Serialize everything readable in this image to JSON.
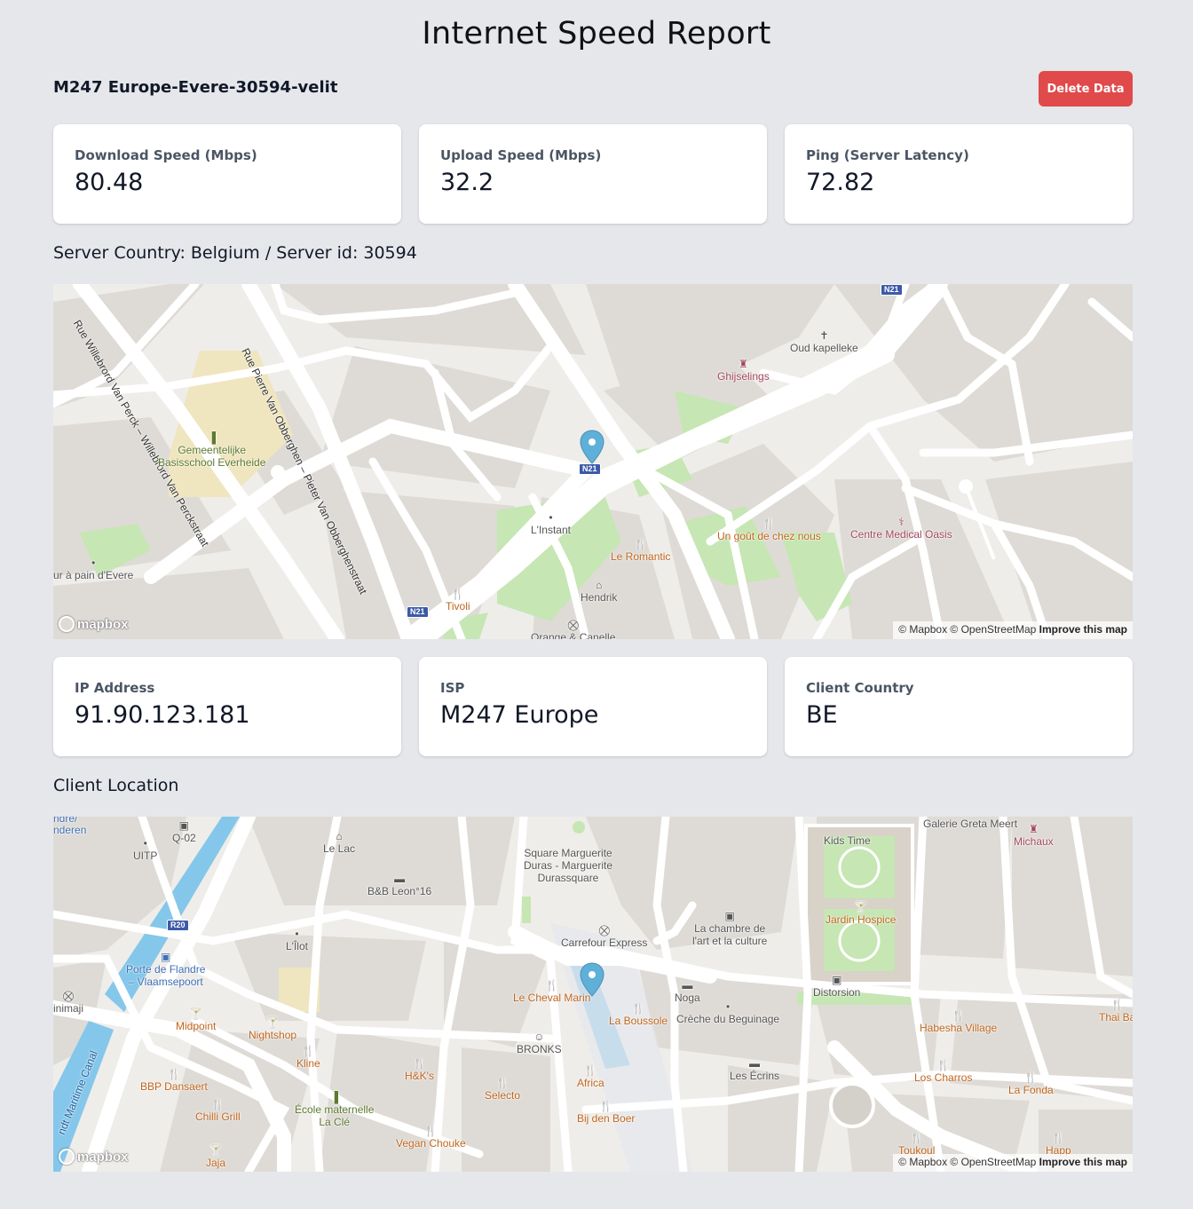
{
  "page_title": "Internet Speed Report",
  "server_name": "M247 Europe-Evere-30594-velit",
  "delete_button": "Delete Data",
  "metrics": [
    {
      "label": "Download Speed (Mbps)",
      "value": "80.48"
    },
    {
      "label": "Upload Speed (Mbps)",
      "value": "32.2"
    },
    {
      "label": "Ping (Server Latency)",
      "value": "72.82"
    }
  ],
  "server_location_label": "Server Country: Belgium / Server id: 30594",
  "client_info": [
    {
      "label": "IP Address",
      "value": "91.90.123.181"
    },
    {
      "label": "ISP",
      "value": "M247 Europe"
    },
    {
      "label": "Client Country",
      "value": "BE"
    }
  ],
  "client_location_label": "Client Location",
  "map_common": {
    "logo_text": "mapbox",
    "attribution": "© Mapbox © OpenStreetMap",
    "improve": "Improve this map",
    "marker_color": "#5fb0d8"
  },
  "server_map": {
    "streets": [
      "Rue Willebrord Van Perck – Willebrord Van Perckstraat",
      "Rue Pierre Van Obberghen – Pieter Van Obberghenstraat"
    ],
    "shields": [
      "N21",
      "N21",
      "N21"
    ],
    "pois": [
      {
        "name": "Oud kapelleke",
        "icon": "✝",
        "color": "gray"
      },
      {
        "name": "Ghijselings",
        "icon": "♜",
        "color": "pink"
      },
      {
        "name": "Gemeentelijke\nBasisschool Everheide",
        "icon": "▐",
        "color": "green"
      },
      {
        "name": "L'Instant",
        "icon": "•",
        "color": "gray"
      },
      {
        "name": "Le Romantic",
        "icon": "🍴",
        "color": "orange"
      },
      {
        "name": "Un goût de chez nous",
        "icon": "🍴",
        "color": "orange"
      },
      {
        "name": "Centre Medical Oasis",
        "icon": "⚕",
        "color": "pink"
      },
      {
        "name": "Hendrik",
        "icon": "⌂",
        "color": "gray"
      },
      {
        "name": "Tivoli",
        "icon": "🍴",
        "color": "orange"
      },
      {
        "name": "ur à pain d'Evere",
        "icon": "•",
        "color": "gray"
      },
      {
        "name": "Orange & Canelle",
        "icon": "⛒",
        "color": "gray"
      }
    ]
  },
  "client_map": {
    "shields": [
      "R20"
    ],
    "canal_label": "ndt Maritime Canal",
    "pois": [
      {
        "name": "ndre/\nnderen",
        "icon": "",
        "color": "blue"
      },
      {
        "name": "Q-02",
        "icon": "▣",
        "color": "gray"
      },
      {
        "name": "UITP",
        "icon": "•",
        "color": "gray"
      },
      {
        "name": "Le Lac",
        "icon": "⌂",
        "color": "gray"
      },
      {
        "name": "B&B Leon°16",
        "icon": "▬",
        "color": "gray"
      },
      {
        "name": "Square Marguerite\nDuras - Marguerite\nDurassquare",
        "icon": "",
        "color": "gray"
      },
      {
        "name": "Galerie Greta Meert",
        "icon": "",
        "color": "gray"
      },
      {
        "name": "Kids Time",
        "icon": "",
        "color": "gray"
      },
      {
        "name": "Michaux",
        "icon": "♜",
        "color": "pink"
      },
      {
        "name": "Carrefour Express",
        "icon": "⛒",
        "color": "gray"
      },
      {
        "name": "La chambre de\nl'art et la culture",
        "icon": "▣",
        "color": "gray"
      },
      {
        "name": "Jardin Hospice",
        "icon": "🍸",
        "color": "orange"
      },
      {
        "name": "L'Îlot",
        "icon": "•",
        "color": "gray"
      },
      {
        "name": "Porte de Flandre\n– Vlaamsepoort",
        "icon": "▣",
        "color": "blue"
      },
      {
        "name": "Le Cheval Marin",
        "icon": "🍴",
        "color": "orange"
      },
      {
        "name": "Noga",
        "icon": "▬",
        "color": "gray"
      },
      {
        "name": "Crèche du Beguinage",
        "icon": "•",
        "color": "gray"
      },
      {
        "name": "Distorsion",
        "icon": "▣",
        "color": "gray"
      },
      {
        "name": "La Boussole",
        "icon": "🍴",
        "color": "orange"
      },
      {
        "name": "inimaji",
        "icon": "⛒",
        "color": "gray"
      },
      {
        "name": "Midpoint",
        "icon": "🍸",
        "color": "orange"
      },
      {
        "name": "Nightshop",
        "icon": "🍸",
        "color": "orange"
      },
      {
        "name": "BRONKS",
        "icon": "☺",
        "color": "gray"
      },
      {
        "name": "Habesha Village",
        "icon": "🍴",
        "color": "orange"
      },
      {
        "name": "Thai Ba",
        "icon": "🍴",
        "color": "orange"
      },
      {
        "name": "Kline",
        "icon": "🍴",
        "color": "orange"
      },
      {
        "name": "H&K's",
        "icon": "🍴",
        "color": "orange"
      },
      {
        "name": "Africa",
        "icon": "🍴",
        "color": "orange"
      },
      {
        "name": "Les Écrins",
        "icon": "▬",
        "color": "gray"
      },
      {
        "name": "Los Charros",
        "icon": "🍴",
        "color": "orange"
      },
      {
        "name": "La Fonda",
        "icon": "🍴",
        "color": "orange"
      },
      {
        "name": "BBP Dansaert",
        "icon": "🍴",
        "color": "orange"
      },
      {
        "name": "Selecto",
        "icon": "🍴",
        "color": "orange"
      },
      {
        "name": "Chilli Grill",
        "icon": "🍴",
        "color": "orange"
      },
      {
        "name": "École maternelle\nLa Clé",
        "icon": "▐",
        "color": "green"
      },
      {
        "name": "Bij den Boer",
        "icon": "🍴",
        "color": "orange"
      },
      {
        "name": "Vegan Chouke",
        "icon": "🍴",
        "color": "orange"
      },
      {
        "name": "Toukoul",
        "icon": "🍴",
        "color": "orange"
      },
      {
        "name": "Happ",
        "icon": "🍴",
        "color": "orange"
      },
      {
        "name": "Jaja",
        "icon": "🍸",
        "color": "orange"
      }
    ]
  }
}
